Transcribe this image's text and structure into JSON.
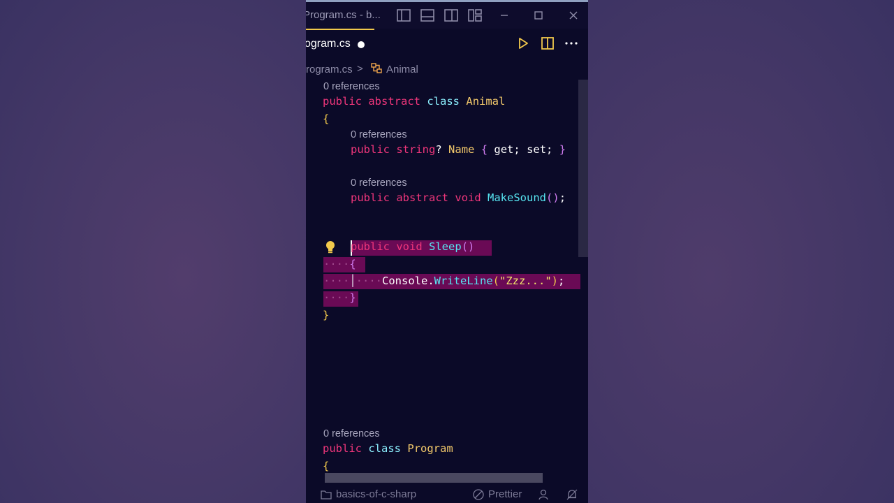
{
  "titlebar": {
    "title": "Program.cs - b..."
  },
  "tab": {
    "label": "ogram.cs"
  },
  "breadcrumb": {
    "file": "rogram.cs",
    "separator": ">",
    "symbol": "Animal"
  },
  "code": {
    "lens1": "0 references",
    "l1_public": "public",
    "l1_abstract": "abstract",
    "l1_class": "class",
    "l1_name": "Animal",
    "l2_brace": "{",
    "lens2": "0 references",
    "l3_public": "public",
    "l3_string": "string",
    "l3_q": "?",
    "l3_name": "Name",
    "l3_open": "{",
    "l3_get": "get;",
    "l3_set": "set;",
    "l3_close": "}",
    "lens3": "0 references",
    "l4_public": "public",
    "l4_abstract": "abstract",
    "l4_void": "void",
    "l4_method": "MakeSound",
    "l4_parens": "()",
    "l4_semi": ";",
    "l5_public": "public",
    "l5_void": "void",
    "l5_method": "Sleep",
    "l5_parens": "()",
    "l6_brace": "{",
    "l7_console": "Console",
    "l7_dot": ".",
    "l7_method": "WriteLine",
    "l7_open": "(",
    "l7_string": "\"Zzz...\"",
    "l7_close": ")",
    "l7_semi": ";",
    "l8_brace": "}",
    "l9_brace": "}",
    "lens4": "0 references",
    "l10_public": "public",
    "l10_class": "class",
    "l10_name": "Program",
    "l11_brace": "{",
    "indent_dots": "····",
    "indent_dots2": "····"
  },
  "statusbar": {
    "folder": "basics-of-c-sharp",
    "formatter": "Prettier"
  },
  "colors": {
    "keyword": "#f0367b",
    "type": "#f3c96b",
    "function": "#57e6f2",
    "selection": "#6a0a55",
    "background": "#0b0a28"
  }
}
